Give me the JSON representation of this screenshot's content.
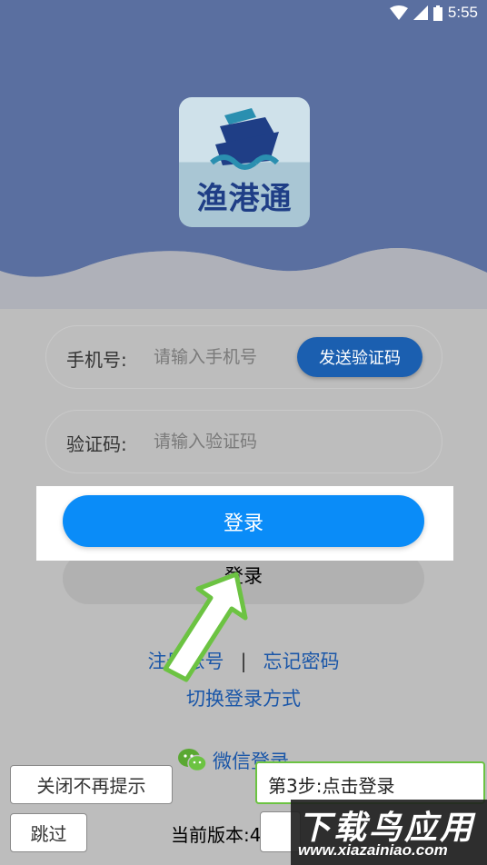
{
  "status_bar": {
    "time": "5:55"
  },
  "logo": {
    "text": "渔港通"
  },
  "form": {
    "phone_label": "手机号:",
    "phone_placeholder": "请输入手机号",
    "send_code_label": "发送验证码",
    "code_label": "验证码:",
    "code_placeholder": "请输入验证码",
    "login_label": "登录",
    "login_label_dim": "登录"
  },
  "links": {
    "register": "注册账号",
    "separator": "|",
    "forgot_password": "忘记密码",
    "switch_login": "切换登录方式",
    "wechat_login": "微信登录"
  },
  "tutorial": {
    "close_tip": "关闭不再提示",
    "skip": "跳过",
    "step": "第3步:点击登录"
  },
  "version": {
    "text": "当前版本:4.0"
  },
  "watermark": {
    "title": "下载鸟应用",
    "url": "www.xiazainiao.com"
  },
  "colors": {
    "header": "#5a6fa0",
    "primary_button": "#0a8cf8",
    "send_button": "#1b5fb0",
    "link": "#1a56a8",
    "tip_border": "#6cc342"
  }
}
